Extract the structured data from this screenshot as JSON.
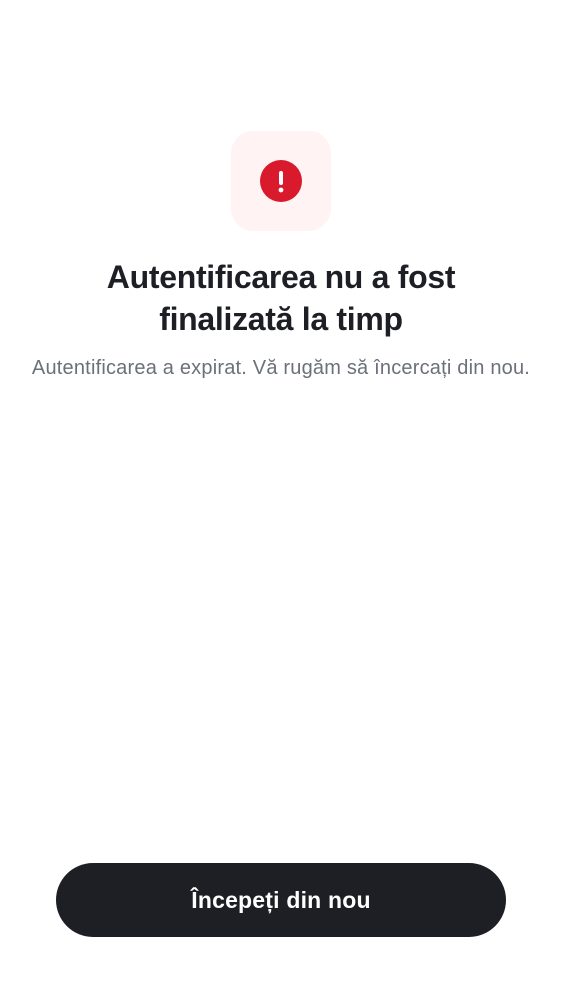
{
  "alert": {
    "icon": "exclamation-icon",
    "accent_color": "#d81a2c",
    "tile_color": "#fff4f3"
  },
  "content": {
    "title": "Autentificarea nu a fost finalizată la timp",
    "message": "Autentificarea a expirat. Vă rugăm să încercați din nou."
  },
  "actions": {
    "restart_label": "Începeți din nou",
    "button_color": "#1e1f24"
  }
}
